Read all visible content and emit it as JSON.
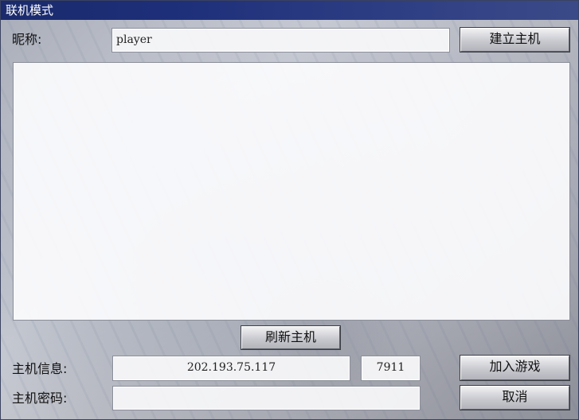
{
  "window": {
    "title": "联机模式"
  },
  "nickname": {
    "label": "昵称:",
    "value": "player"
  },
  "buttons": {
    "create_host": "建立主机",
    "refresh_host": "刷新主机",
    "join_game": "加入游戏",
    "cancel": "取消"
  },
  "host_info": {
    "label": "主机信息:",
    "ip": "202.193.75.117",
    "port": "7911"
  },
  "host_password": {
    "label": "主机密码:",
    "value": ""
  },
  "host_list": {
    "items": []
  }
}
